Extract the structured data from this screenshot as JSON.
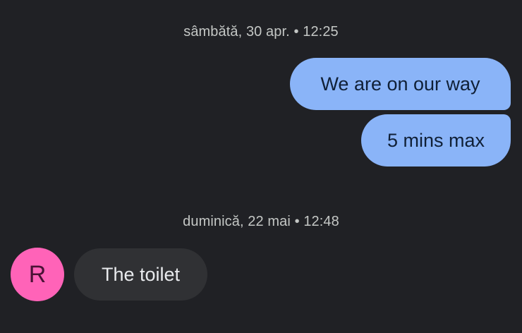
{
  "thread": {
    "groups": [
      {
        "timestamp": "sâmbătă, 30 apr. • 12:25",
        "messages": [
          {
            "direction": "outgoing",
            "text": "We are on our way"
          },
          {
            "direction": "outgoing",
            "text": "5 mins max"
          }
        ]
      },
      {
        "timestamp": "duminică, 22 mai • 12:48",
        "messages": [
          {
            "direction": "incoming",
            "sender_initial": "R",
            "text": "The toilet"
          }
        ]
      }
    ]
  },
  "colors": {
    "background": "#202125",
    "outgoing_bubble": "#8ab4f8",
    "incoming_bubble": "#303134",
    "avatar": "#ff63b8",
    "timestamp_text": "#c4c7c5"
  }
}
